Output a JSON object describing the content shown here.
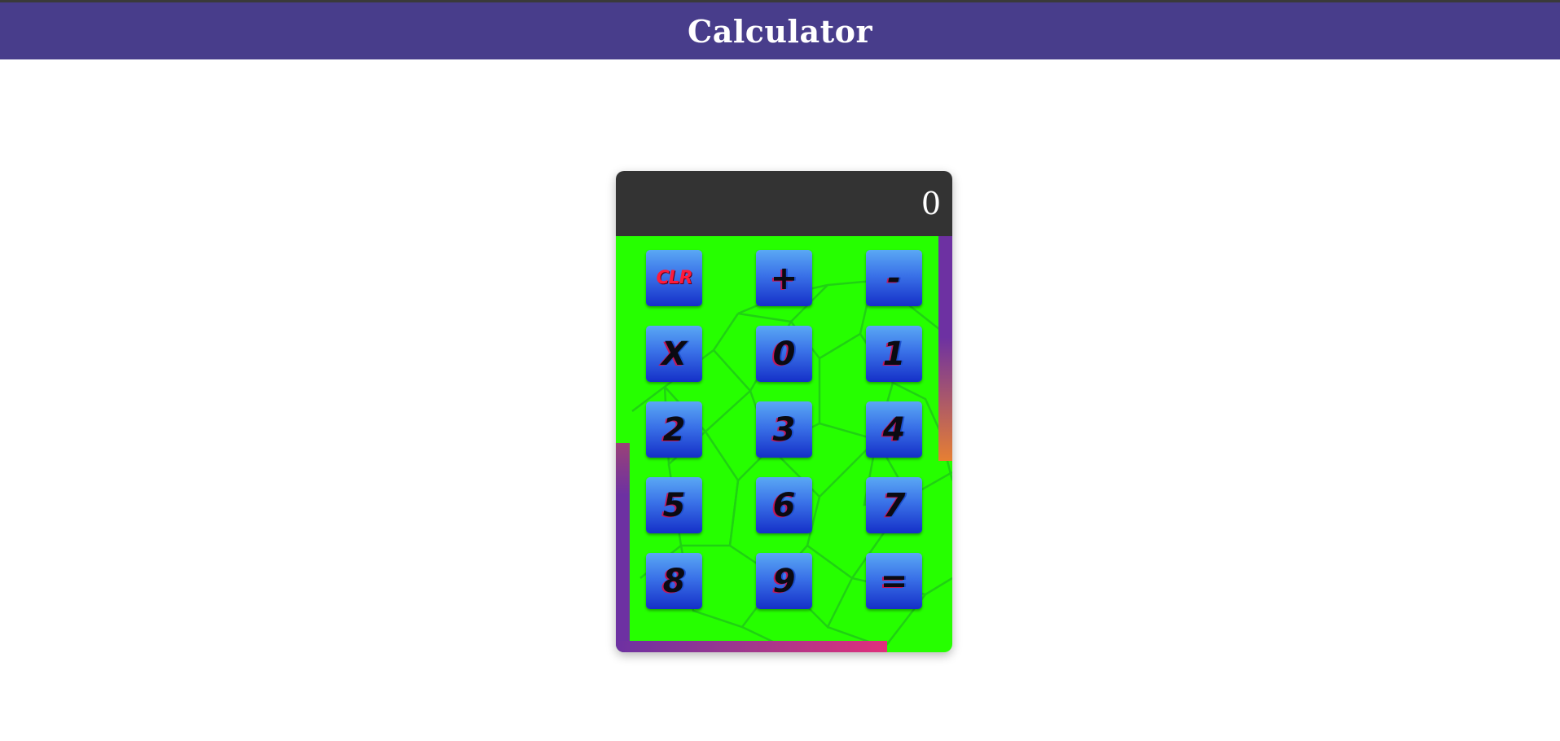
{
  "app": {
    "title": "Calculator"
  },
  "colors": {
    "header_bg": "#483d8b",
    "display_bg": "#333333",
    "pad_bg": "#26ff00",
    "key_gradient_top": "#5aa8f4",
    "key_gradient_bottom": "#1530c8",
    "clear_key_text": "#ff1a3a"
  },
  "display": {
    "value": "0"
  },
  "keys": [
    {
      "label": "CLR",
      "name": "clear-button"
    },
    {
      "label": "+",
      "name": "plus-button"
    },
    {
      "label": "-",
      "name": "minus-button"
    },
    {
      "label": "X",
      "name": "multiply-button"
    },
    {
      "label": "0",
      "name": "digit-0-button"
    },
    {
      "label": "1",
      "name": "digit-1-button"
    },
    {
      "label": "2",
      "name": "digit-2-button"
    },
    {
      "label": "3",
      "name": "digit-3-button"
    },
    {
      "label": "4",
      "name": "digit-4-button"
    },
    {
      "label": "5",
      "name": "digit-5-button"
    },
    {
      "label": "6",
      "name": "digit-6-button"
    },
    {
      "label": "7",
      "name": "digit-7-button"
    },
    {
      "label": "8",
      "name": "digit-8-button"
    },
    {
      "label": "9",
      "name": "digit-9-button"
    },
    {
      "label": "=",
      "name": "equals-button"
    }
  ]
}
